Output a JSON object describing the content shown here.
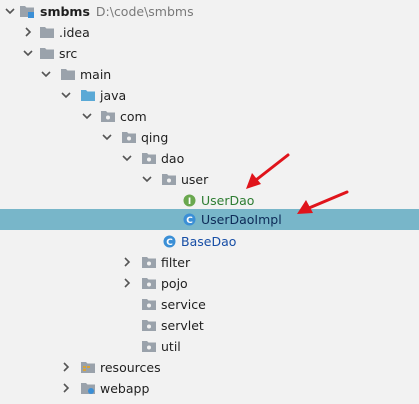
{
  "project": {
    "name": "smbms",
    "path": "D:\\code\\smbms"
  },
  "nodes": {
    "idea": ".idea",
    "src": "src",
    "main": "main",
    "java": "java",
    "com": "com",
    "qing": "qing",
    "dao": "dao",
    "user": "user",
    "userdao": "UserDao",
    "userdaoimpl": "UserDaoImpl",
    "basedao": "BaseDao",
    "filter": "filter",
    "pojo": "pojo",
    "service": "service",
    "servlet": "servlet",
    "util": "util",
    "resources": "resources",
    "webapp": "webapp"
  },
  "icons": {
    "interface_letter": "I",
    "class_letter": "C"
  },
  "colors": {
    "selection": "#78b6c9",
    "arrow": "#e0141b",
    "folder": "#9aa2ab",
    "source_folder": "#5aa9d6",
    "interface_icon": "#6aa84f",
    "class_icon": "#3b8fd6"
  }
}
